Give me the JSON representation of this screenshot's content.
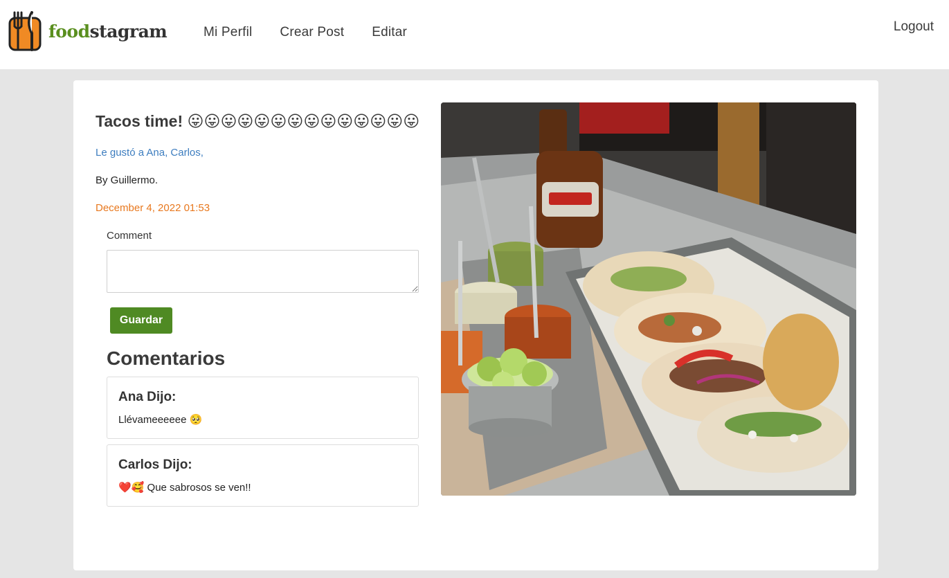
{
  "app": {
    "brand_food": "food",
    "brand_stagram": "stagram",
    "logo_icon": "fork-knife-icon"
  },
  "nav": {
    "items": [
      {
        "label": "Mi Perfil"
      },
      {
        "label": "Crear Post"
      },
      {
        "label": "Editar"
      }
    ],
    "logout_label": "Logout"
  },
  "post": {
    "title": "Tacos time! 😛😛😛😛😛😛😛😛😛😛😛😛😛😛",
    "likes": "Le gustó a Ana, Carlos,",
    "author": "By Guillermo.",
    "date": "December 4, 2022 01:53",
    "image_icon": "tacos-photo"
  },
  "comment_form": {
    "label": "Comment",
    "value": "",
    "placeholder": "",
    "submit_label": "Guardar"
  },
  "comments": {
    "heading": "Comentarios",
    "items": [
      {
        "author": "Ana Dijo:",
        "text": "Llévameeeeee 🥺"
      },
      {
        "author": "Carlos Dijo:",
        "text": "❤️🥰 Que sabrosos se ven!!"
      }
    ]
  },
  "colors": {
    "brand_green": "#5a8f1f",
    "button_green": "#4f8a23",
    "link_blue": "#3d7dbf",
    "date_orange": "#e8781e",
    "page_bg": "#e5e5e5"
  }
}
